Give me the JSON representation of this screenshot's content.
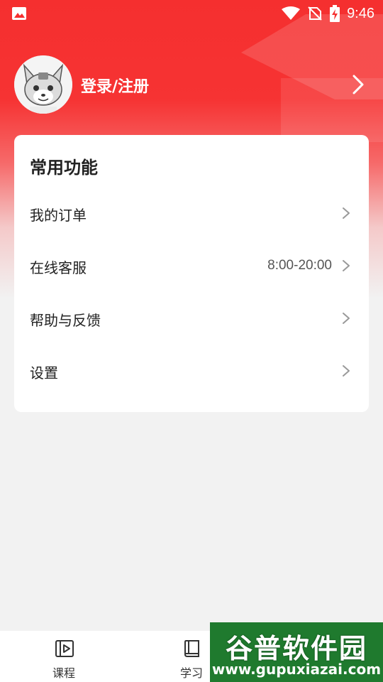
{
  "status_bar": {
    "time": "9:46",
    "icons": [
      "image-icon",
      "wifi-icon",
      "no-sim-icon",
      "battery-charging-icon"
    ]
  },
  "profile": {
    "login_label": "登录/注册",
    "avatar_icon": "fox-avatar-icon"
  },
  "features": {
    "title": "常用功能",
    "items": [
      {
        "label": "我的订单",
        "value": ""
      },
      {
        "label": "在线客服",
        "value": "8:00-20:00"
      },
      {
        "label": "帮助与反馈",
        "value": ""
      },
      {
        "label": "设置",
        "value": ""
      }
    ]
  },
  "bottom_nav": {
    "items": [
      {
        "label": "课程",
        "icon": "video-play-icon"
      },
      {
        "label": "学习",
        "icon": "book-icon"
      }
    ]
  },
  "watermark": {
    "title": "谷普软件园",
    "url": "www.gupuxiazai.com"
  },
  "colors": {
    "header_red": "#f52f2f",
    "background": "#f2f2f2",
    "card": "#ffffff",
    "watermark_green": "#1f7a2e"
  }
}
